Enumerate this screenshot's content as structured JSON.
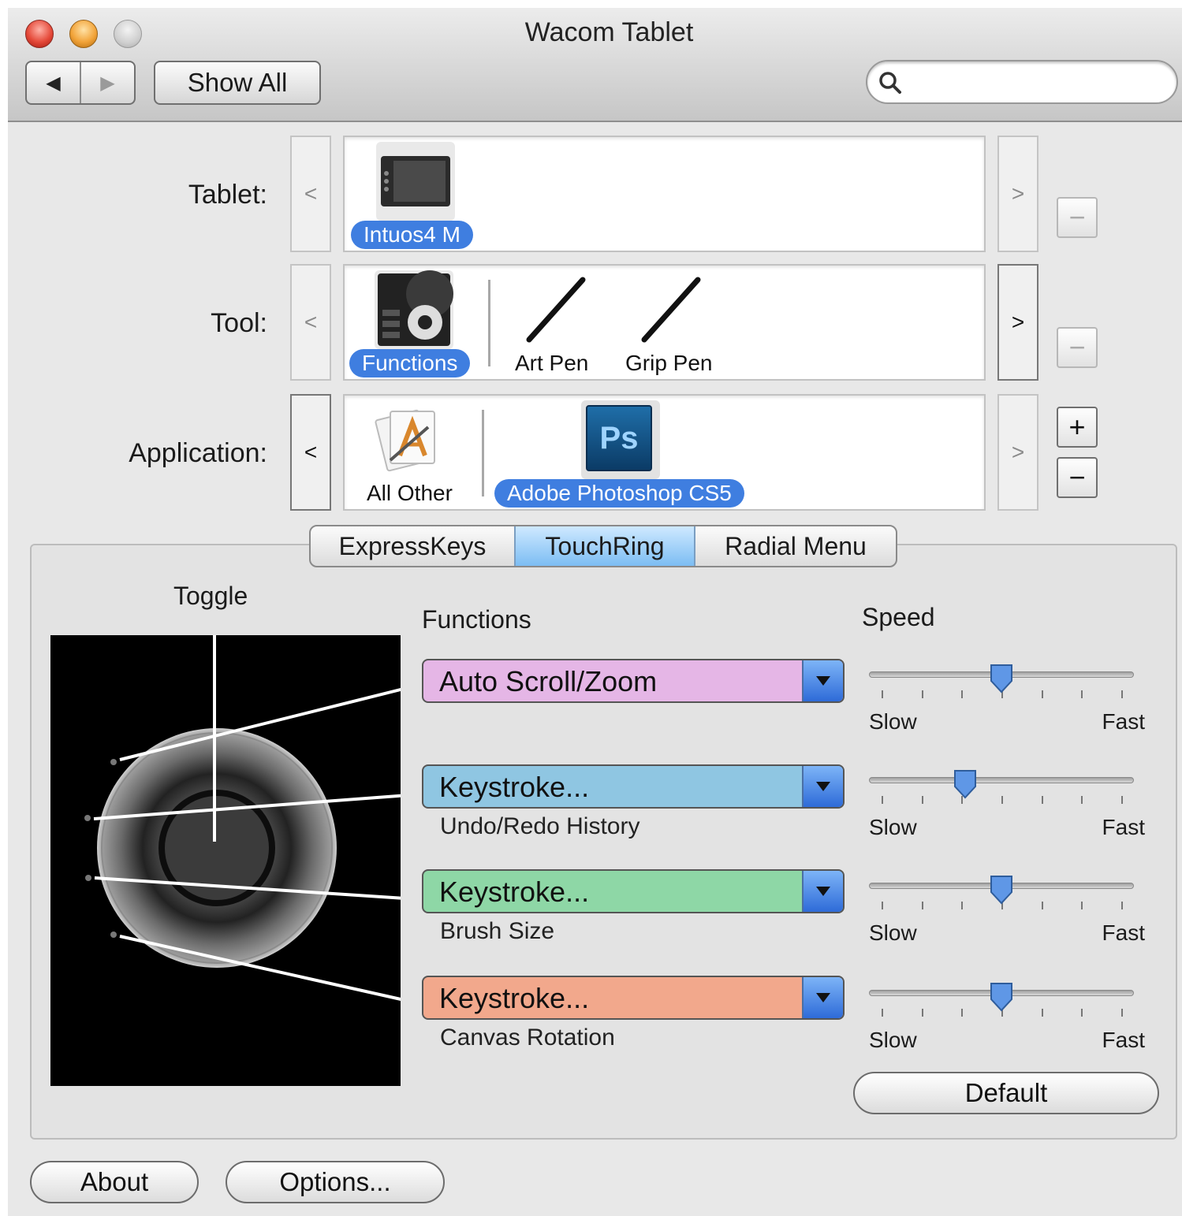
{
  "window": {
    "title": "Wacom Tablet"
  },
  "toolbar": {
    "back_glyph": "◀",
    "forward_glyph": "▶",
    "show_all": "Show All",
    "search_placeholder": "",
    "search_icon": "magnifier-icon"
  },
  "rows": {
    "tablet": {
      "label": "Tablet:",
      "prev": "<",
      "next": ">",
      "remove": "−",
      "items": [
        {
          "label": "Intuos4 M",
          "icon": "tablet-icon",
          "selected": true
        }
      ]
    },
    "tool": {
      "label": "Tool:",
      "prev": "<",
      "next": ">",
      "remove": "−",
      "items": [
        {
          "label": "Functions",
          "icon": "functions-icon",
          "selected": true
        },
        {
          "label": "Art Pen",
          "icon": "pen-icon",
          "selected": false
        },
        {
          "label": "Grip Pen",
          "icon": "pen-icon",
          "selected": false
        }
      ]
    },
    "application": {
      "label": "Application:",
      "prev": "<",
      "next": ">",
      "add": "+",
      "remove": "−",
      "items": [
        {
          "label": "All Other",
          "icon": "applications-icon",
          "selected": false
        },
        {
          "label": "Adobe Photoshop CS5",
          "icon": "photoshop-icon",
          "icon_text": "Ps",
          "selected": true
        }
      ]
    }
  },
  "tabs": [
    "ExpressKeys",
    "TouchRing",
    "Radial Menu"
  ],
  "active_tab": "TouchRing",
  "touchring": {
    "toggle_label": "Toggle",
    "functions_title": "Functions",
    "speed_title": "Speed",
    "functions": [
      {
        "value": "Auto Scroll/Zoom",
        "sublabel": "",
        "color": "#e5b6e6"
      },
      {
        "value": "Keystroke...",
        "sublabel": "Undo/Redo History",
        "color": "#8fc6e2"
      },
      {
        "value": "Keystroke...",
        "sublabel": "Brush Size",
        "color": "#8ed7a6"
      },
      {
        "value": "Keystroke...",
        "sublabel": "Canvas Rotation",
        "color": "#f2a88c"
      }
    ],
    "speeds": [
      {
        "level": 0.5,
        "slow": "Slow",
        "fast": "Fast"
      },
      {
        "level": 0.35,
        "slow": "Slow",
        "fast": "Fast"
      },
      {
        "level": 0.5,
        "slow": "Slow",
        "fast": "Fast"
      },
      {
        "level": 0.5,
        "slow": "Slow",
        "fast": "Fast"
      }
    ],
    "default_button": "Default"
  },
  "footer": {
    "about": "About",
    "options": "Options..."
  },
  "colors": {
    "selection_blue": "#3f7ee0",
    "tab_active": "#7cbdf3"
  }
}
